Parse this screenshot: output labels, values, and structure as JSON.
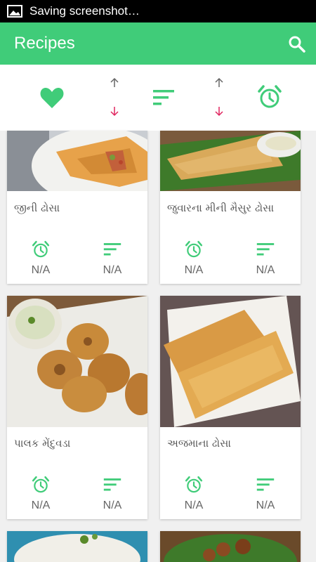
{
  "status_bar": {
    "notification_text": "Saving screenshot…",
    "icon": "image-icon"
  },
  "app_bar": {
    "title": "Recipes",
    "search_icon": "search-icon"
  },
  "toolbar": {
    "favorite_icon": "heart-icon",
    "sort_asc_icon": "arrow-up-icon",
    "sort_desc_icon": "arrow-down-icon",
    "filter_icon": "sort-lines-icon",
    "time_icon": "alarm-clock-icon"
  },
  "colors": {
    "accent": "#40cc79",
    "desc_arrow": "#e0245e",
    "asc_arrow": "#666666"
  },
  "recipes": [
    {
      "name": "જીની ઢોસા",
      "time": "N/A",
      "servings": "N/A"
    },
    {
      "name": "જુવારના મીની મૈસુર ઢોસા",
      "time": "N/A",
      "servings": "N/A"
    },
    {
      "name": "પાલક મેંદુવડા",
      "time": "N/A",
      "servings": "N/A"
    },
    {
      "name": "અજમાના ઢોસા",
      "time": "N/A",
      "servings": "N/A"
    }
  ]
}
